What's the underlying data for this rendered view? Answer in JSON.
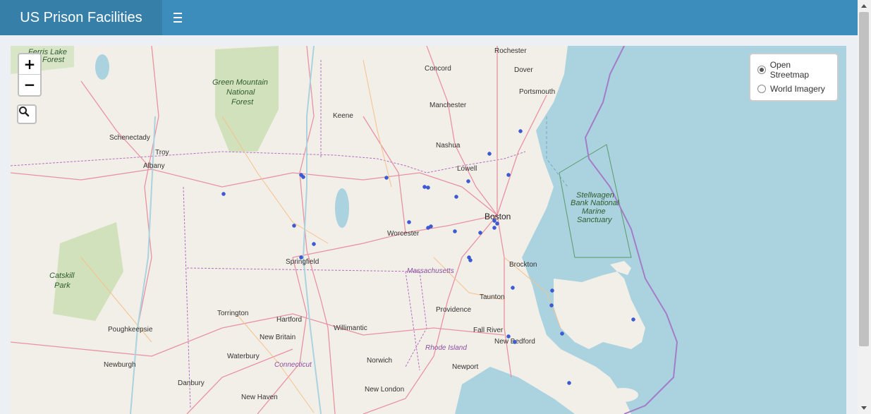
{
  "header": {
    "title": "US Prison Facilities",
    "menu_icon": "hamburger-icon",
    "color": "#3c8dbc",
    "logo_color": "#367fa9"
  },
  "map": {
    "zoom_in": "+",
    "zoom_out": "−",
    "search_icon": "search-icon",
    "layers": [
      {
        "label": "Open Streetmap",
        "selected": true
      },
      {
        "label": "World Imagery",
        "selected": false
      }
    ],
    "place_labels": [
      "Ferris Lake",
      "Forest",
      "Green Mountain",
      "National",
      "Forest",
      "Rochester",
      "Concord",
      "Dover",
      "Portsmouth",
      "Manchester",
      "Keene",
      "Schenectady",
      "Troy",
      "Albany",
      "Nashua",
      "Lowell",
      "Boston",
      "Stellwagen",
      "Bank National",
      "Marine",
      "Sanctuary",
      "Worcester",
      "Springfield",
      "Massachusetts",
      "Brockton",
      "Catskill",
      "Park",
      "Taunton",
      "Providence",
      "Torrington",
      "Hartford",
      "Willimantic",
      "Fall River",
      "Poughkeepsie",
      "New Britain",
      "New Bedford",
      "Rhode Island",
      "Waterbury",
      "Connecticut",
      "Norwich",
      "Newport",
      "Newburgh",
      "Danbury",
      "New London",
      "New Haven"
    ],
    "marker_color": "#3b5bdb",
    "water_color": "#aad3df",
    "land_color": "#f2efe9"
  }
}
